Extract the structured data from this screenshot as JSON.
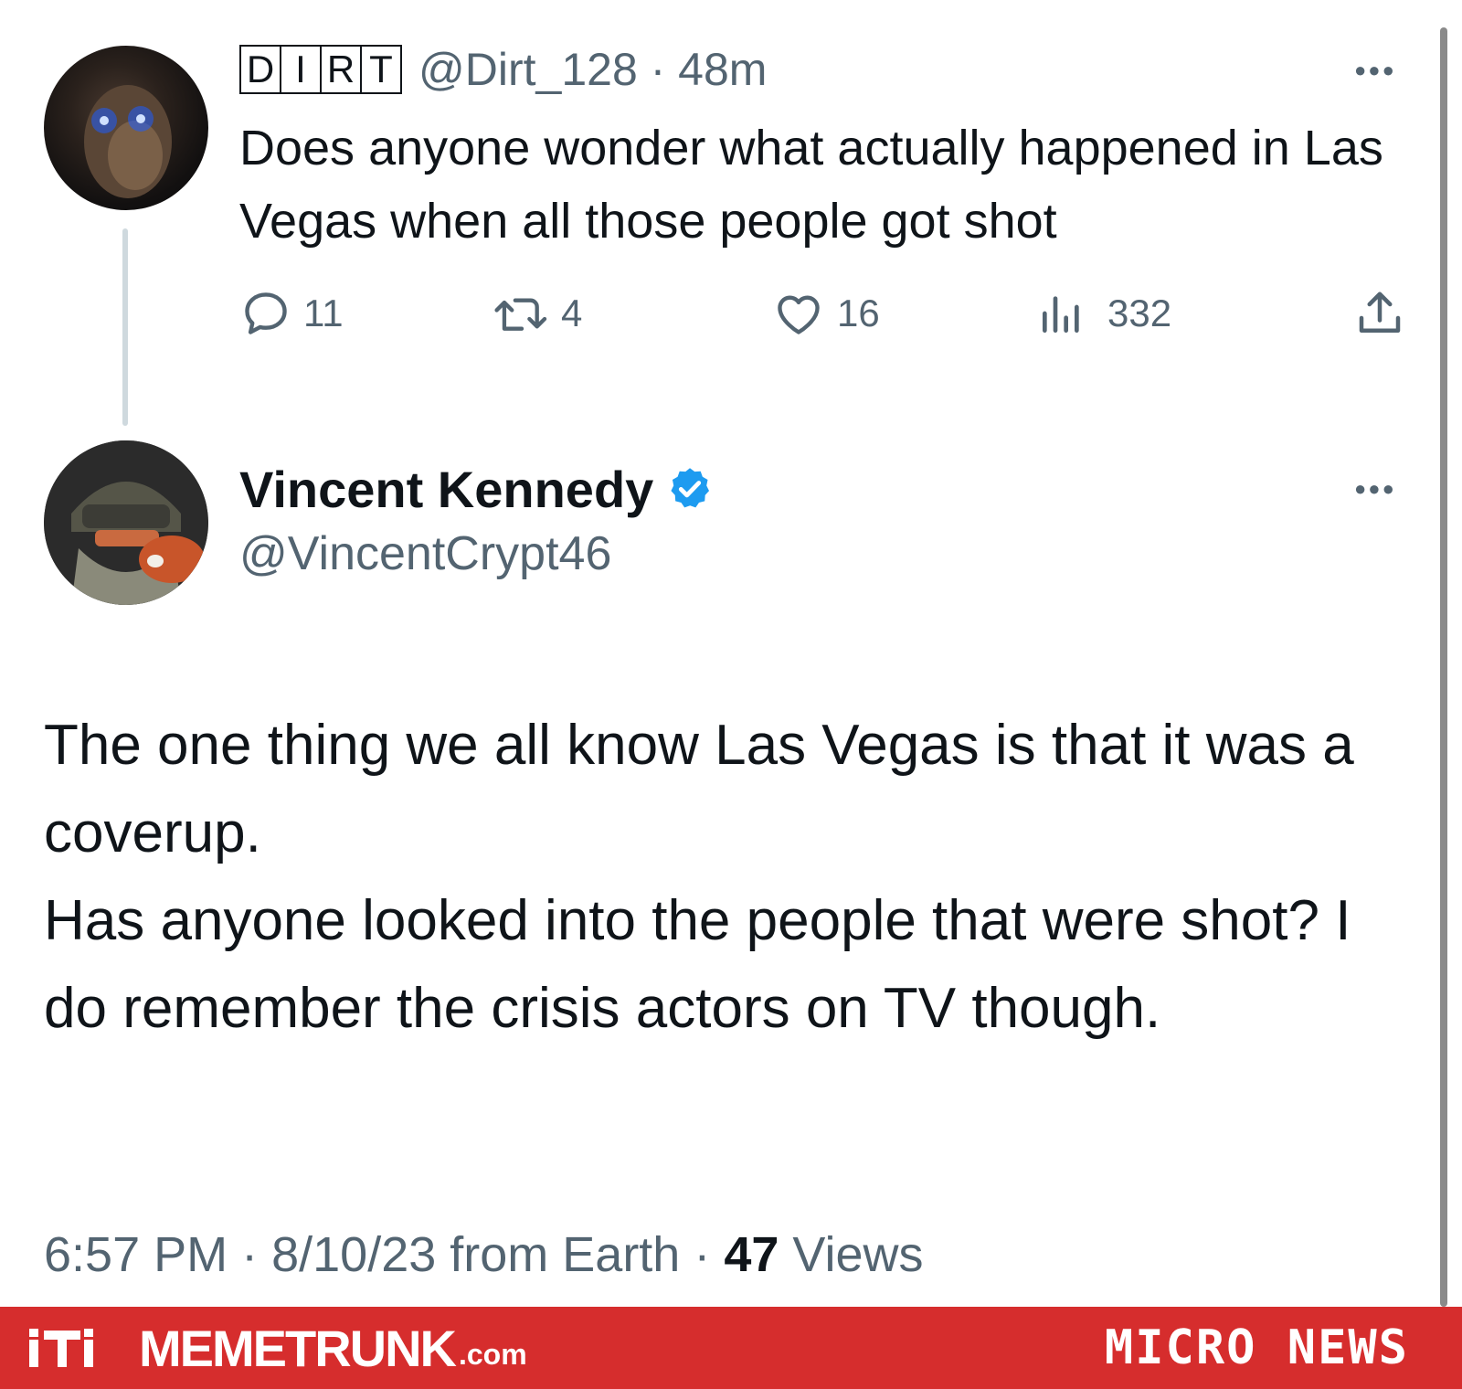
{
  "parent_tweet": {
    "display_name_letters": [
      "D",
      "I",
      "R",
      "T"
    ],
    "handle_time": "@Dirt_128 · 48m",
    "text": "Does anyone wonder what actually happened in Las Vegas when all those people got shot",
    "replies": "11",
    "retweets": "4",
    "likes": "16",
    "views": "332",
    "more_icon": "more-dots-icon"
  },
  "reply_tweet": {
    "name": "Vincent Kennedy",
    "handle": "@VincentCrypt46",
    "verified_icon": "verified-badge-icon",
    "lines": [
      "The one thing we all know Las Vegas is that it was a coverup.",
      "Has anyone looked into the people that were shot? I do remember the crisis actors on TV though."
    ],
    "meta_prefix": "6:57 PM · 8/10/23 from Earth · ",
    "meta_views_count": "47",
    "meta_views_label": " Views"
  },
  "footer": {
    "brand_name": "MEMETRUNK",
    "brand_tld": ".com",
    "section": "MICRO NEWS"
  },
  "colors": {
    "secondary_text": "#536471",
    "verified_blue": "#1d9bf0",
    "footer_red": "#d62d2d",
    "thread_line": "#cfd9de"
  }
}
